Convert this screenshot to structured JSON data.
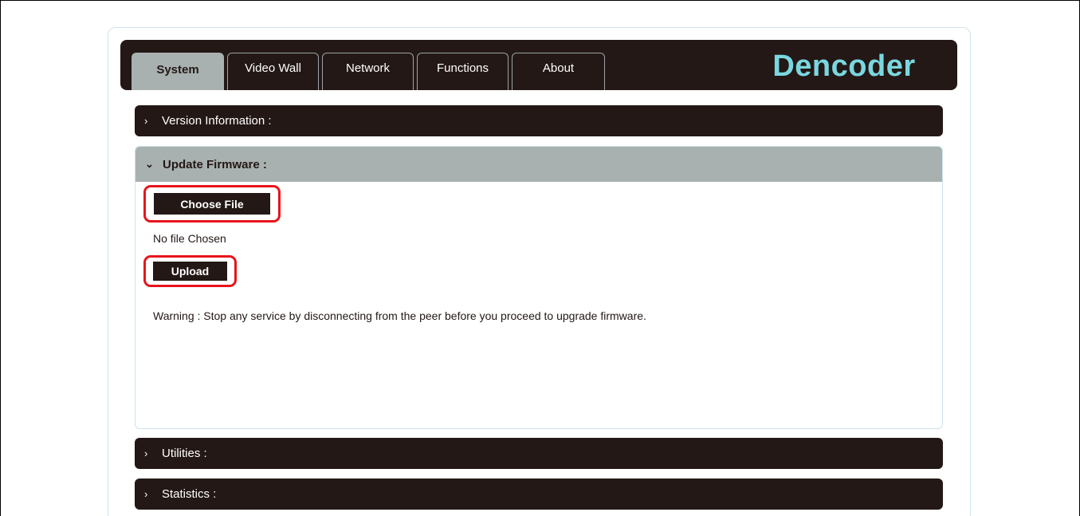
{
  "tabs": [
    {
      "label": "System",
      "active": true
    },
    {
      "label": "Video Wall",
      "active": false
    },
    {
      "label": "Network",
      "active": false
    },
    {
      "label": "Functions",
      "active": false
    },
    {
      "label": "About",
      "active": false
    }
  ],
  "brand": "Dencoder",
  "sections": {
    "version": {
      "chevron": "›",
      "label": "Version Information :"
    },
    "firmware": {
      "chevron": "⌄",
      "label": "Update Firmware :",
      "choose_file_label": "Choose File",
      "file_status": "No file Chosen",
      "upload_label": "Upload",
      "warning": "Warning : Stop any service by disconnecting from the peer before you proceed to upgrade firmware."
    },
    "utilities": {
      "chevron": "›",
      "label": "Utilities :"
    },
    "statistics": {
      "chevron": "›",
      "label": "Statistics :"
    }
  },
  "colors": {
    "dark": "#231815",
    "accent": "#7ad7e0",
    "active_tab": "#a9b1b0",
    "highlight": "#e8141b"
  }
}
